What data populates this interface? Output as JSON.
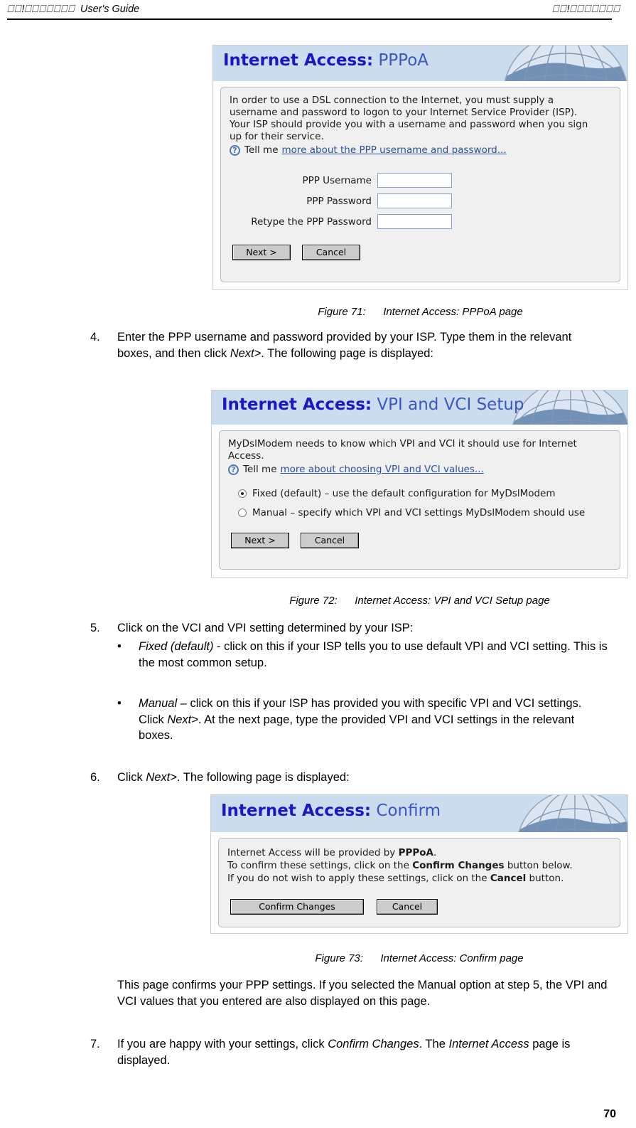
{
  "header": {
    "left_tofu_1": "⎕⎕",
    "left_bang": "!",
    "left_tofu_2": "⎕⎕⎕⎕⎕⎕⎕",
    "left_guide": "User's Guide",
    "right_tofu_1": "⎕⎕",
    "right_bang": "!",
    "right_tofu_2": "⎕⎕⎕⎕⎕⎕⎕"
  },
  "colors": {
    "banner_bg": "#ccdcef",
    "title_strong": "#1b17c6",
    "title_light": "#3b57c4",
    "link": "#2b4f9e",
    "panel_bg": "#eff0ef",
    "button_face": "#cccccc"
  },
  "figure71": {
    "title_strong": "Internet Access:",
    "title_light": "PPPoA",
    "body_text": "In order to use a DSL connection to the Internet, you must supply a\nusername and password to logon to your Internet Service Provider (ISP).\nYour ISP should provide you with a username and password when you sign\nup for their service.",
    "help_icon": "?",
    "tell_me": "Tell me",
    "help_link": "more about the PPP username and password...",
    "fields": [
      {
        "label": "PPP Username",
        "value": ""
      },
      {
        "label": "PPP Password",
        "value": ""
      },
      {
        "label": "Retype the PPP Password",
        "value": ""
      }
    ],
    "buttons": {
      "next": "Next >",
      "cancel": "Cancel"
    },
    "caption_num": "Figure 71:",
    "caption_text": "Internet Access: PPPoA page"
  },
  "step4": {
    "num": "4.",
    "t1": "Enter the PPP username and password provided by your ISP. Type them in the relevant boxes, and then click ",
    "em1": "Next>",
    "t2": ". The following page is displayed:"
  },
  "figure72": {
    "title_strong": "Internet Access:",
    "title_light": "VPI and VCI Setup",
    "body_text": "MyDslModem needs to know which VPI and VCI it should use for Internet\nAccess.",
    "help_icon": "?",
    "tell_me": "Tell me",
    "help_link": "more about choosing VPI and VCI values...",
    "options": [
      {
        "label": "Fixed (default) – use the default configuration for MyDslModem",
        "selected": true
      },
      {
        "label": "Manual – specify which VPI and VCI settings MyDslModem should use",
        "selected": false
      }
    ],
    "buttons": {
      "next": "Next >",
      "cancel": "Cancel"
    },
    "caption_num": "Figure 72:",
    "caption_text": "Internet Access: VPI and VCI Setup page"
  },
  "step5": {
    "num": "5.",
    "text": "Click on the VCI and VPI setting determined by your ISP:",
    "bullets": [
      {
        "mark": "•",
        "em1": "Fixed (default)",
        "t1": " - click on this if your ISP tells you to use default VPI and VCI setting. This is the most common setup."
      },
      {
        "mark": "•",
        "em1": "Manual",
        "t1": " – click on this if your ISP has provided you with specific VPI and VCI settings. Click ",
        "em2": "Next>",
        "t2": ". At the next page, type the provided VPI and VCI settings in the relevant boxes."
      }
    ]
  },
  "step6": {
    "num": "6.",
    "t1": "Click ",
    "em1": "Next>",
    "t2": ". The following page is displayed:"
  },
  "figure73": {
    "title_strong": "Internet Access:",
    "title_light": "Confirm",
    "line1_a": "Internet Access will be provided by ",
    "line1_b": "PPPoA",
    "line1_c": ".",
    "line2_a": "To confirm these settings, click on the ",
    "line2_b": "Confirm Changes",
    "line2_c": " button below.",
    "line3_a": "If you do not wish to apply these settings, click on the ",
    "line3_b": "Cancel",
    "line3_c": " button.",
    "buttons": {
      "confirm": "Confirm Changes",
      "cancel": "Cancel"
    },
    "caption_num": "Figure 73:",
    "caption_text": "Internet Access: Confirm page"
  },
  "closing": {
    "para": "This page confirms your PPP settings. If you selected the Manual option at step 5, the VPI and VCI values that you entered are also displayed on this page.",
    "step7_num": "7.",
    "step7_t1": "If you are happy with your settings, click ",
    "step7_em1": "Confirm Changes",
    "step7_t2": ". The ",
    "step7_em2": "Internet Access",
    "step7_t3": " page is displayed."
  },
  "footer": {
    "page_number": "70"
  }
}
